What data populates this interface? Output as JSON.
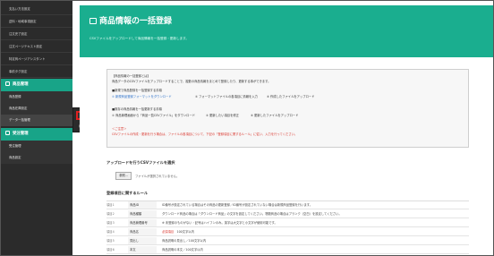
{
  "sidebar": {
    "top_items": [
      {
        "label": "支払い方法設定"
      },
      {
        "label": "送料・地域事項設定"
      },
      {
        "label": "注文完了設定"
      },
      {
        "label": "注文ページテキスト設定"
      },
      {
        "label": "特定商ページアシスタント"
      },
      {
        "label": "事前タグ設定"
      }
    ],
    "product_section": {
      "label": "商品管理"
    },
    "product_items": [
      {
        "label": "商品登録"
      },
      {
        "label": "商品在庫設定"
      },
      {
        "label": "データ一括管理"
      }
    ],
    "order_section": {
      "label": "受注管理"
    },
    "order_items": [
      {
        "label": "受注管理"
      },
      {
        "label": "商品設定"
      }
    ],
    "flyout": [
      {
        "label": "商品データ一括登録"
      },
      {
        "label": "在庫データ一括登録"
      }
    ]
  },
  "header": {
    "title": "商品情報の一括登録",
    "subtitle": "CSVファイルをアップロードして商品情報を一括登録・更新します。"
  },
  "info": {
    "lines": [
      "【商品情報の一括登録とは】",
      "商品データのCSVファイルをアップロードすることで、複数の商品情報をまとめて登録したり、更新する事ができます。",
      "■新規で商品登録を一括登録する手順",
      "① 新規商品登録フォーマットをダウンロード",
      "② フォーマットファイルの各項目に情報を入力",
      "③ 作成したファイルをアップロード",
      "■既存の商品情報を一括更新する手順",
      "① 商品管理画面から「商品一覧CSVファイル」をダウンロード",
      "② 更新したい項目を修正",
      "③ 更新したファイルをアップロード",
      "＜ご注意＞",
      "CSVファイルの作成・更新を行う場合は、ファイルの各項目について、下記の「登録項目に関するルール」に従い、入力を行ってください。"
    ]
  },
  "upload": {
    "title": "アップロードを行うCSVファイルを選択",
    "button": "参照...",
    "placeholder": "ファイルが選択されていません。"
  },
  "rules": {
    "title": "登録項目に関するルール",
    "rows": [
      {
        "req": "項目1",
        "name": "商品ID",
        "req_tag": "",
        "desc": "ID番号が設定されている場合はその商品の更新登録／ID番号が設定されていない場合は新規商品登録を行います。"
      },
      {
        "req": "項目2",
        "name": "商品種類",
        "req_tag": "",
        "desc": "ダウンロード商品の場合は「ダウンロード商品」の文字を設定してください。物販商品の場合はブランク（空白）を設定してください。"
      },
      {
        "req": "項目3",
        "name": "商品管理番号",
        "req_tag": "",
        "desc": "※ 未登録のものがない・記号はハイフンのみ。英字は大文字と小文字が使用可能です。"
      },
      {
        "req": "項目4",
        "name": "商品名",
        "req_tag": "必須項目",
        "desc": "100文字以内"
      },
      {
        "req": "項目5",
        "name": "見出し",
        "req_tag": "",
        "desc": "商品説明の見出し／100文字以内"
      },
      {
        "req": "項目6",
        "name": "本文",
        "req_tag": "",
        "desc": "商品説明の本文／100文字以内"
      }
    ]
  },
  "colors": {
    "accent": "#1aae8f",
    "sidebar_bg": "#2b2b2b",
    "highlight": "#e02020",
    "link": "#2a6fc9",
    "warning": "#d9342b"
  }
}
